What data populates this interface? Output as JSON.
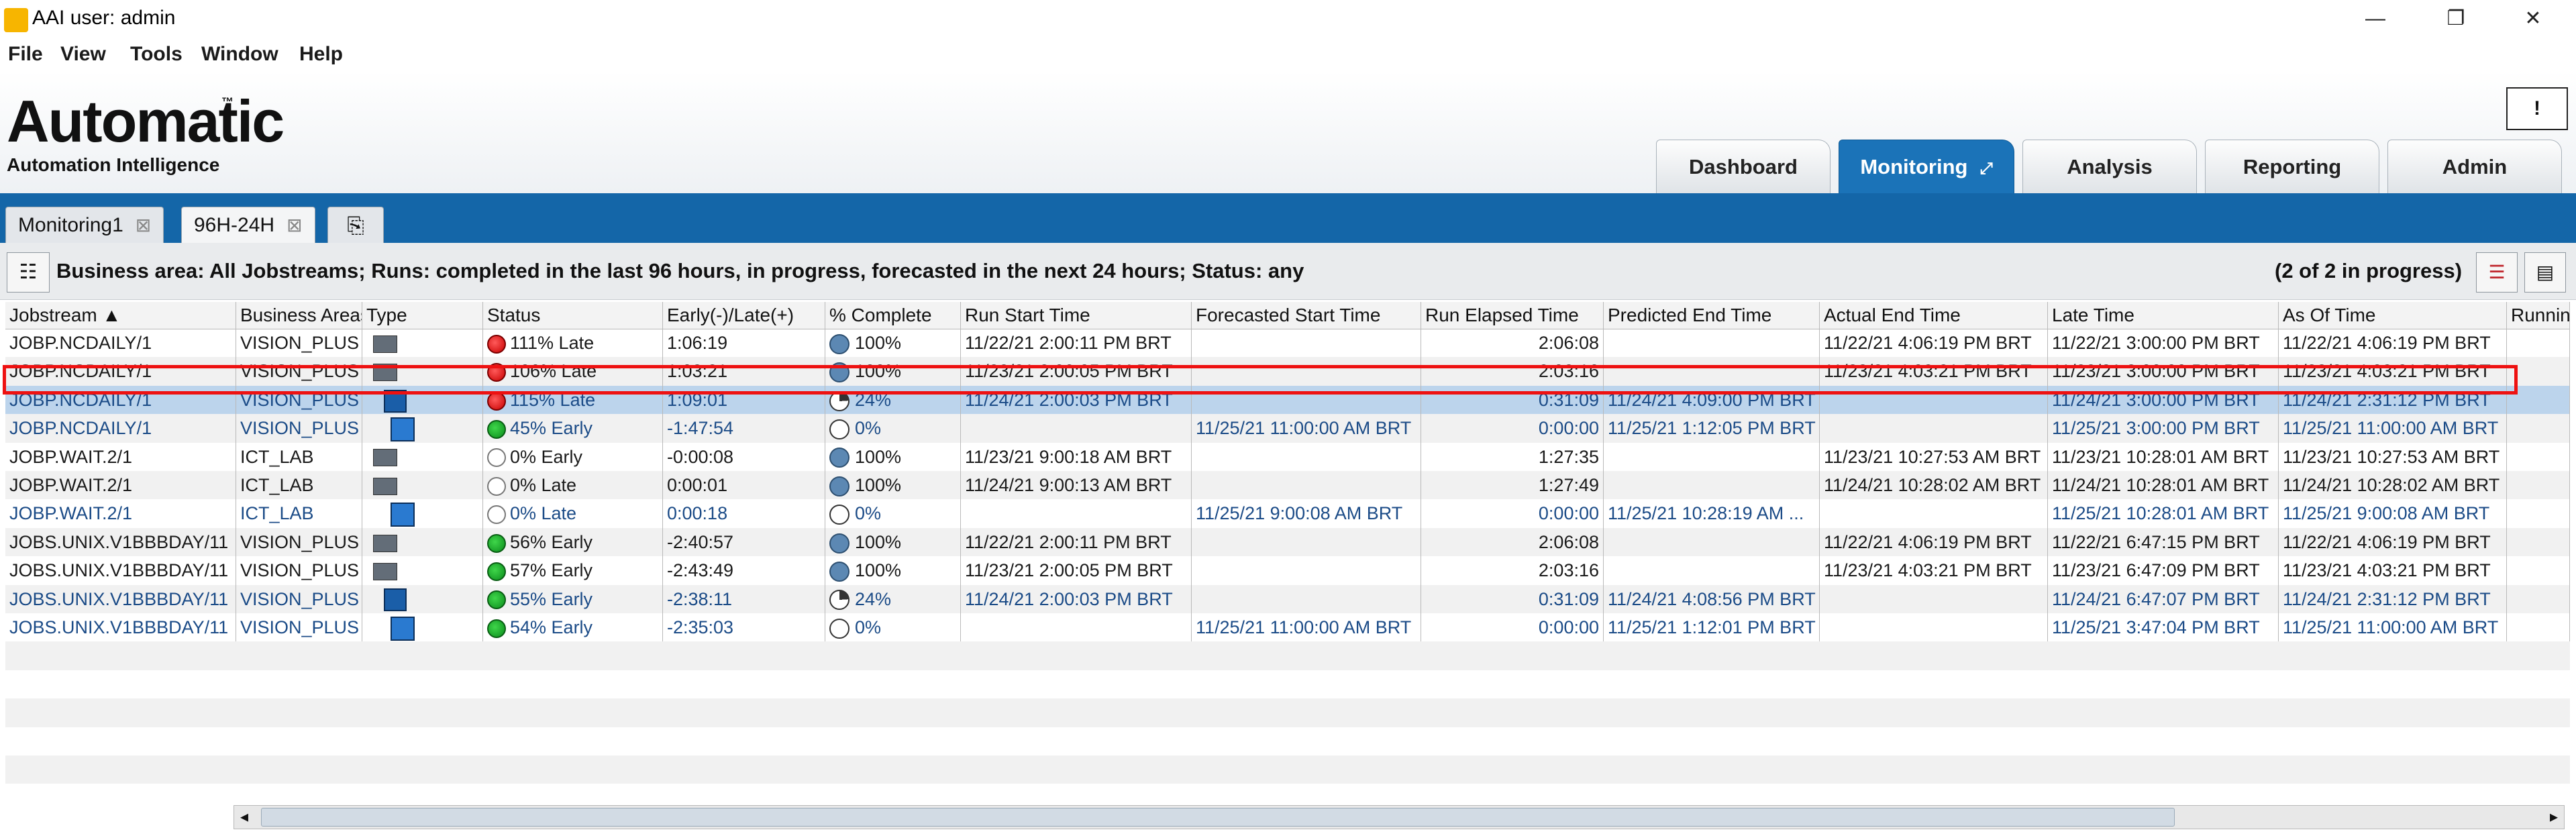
{
  "window": {
    "title": "AAI user: admin",
    "controls": [
      "—",
      "❐",
      "✕"
    ]
  },
  "menu": [
    "File",
    "View",
    "Tools",
    "Window",
    "Help"
  ],
  "brand": {
    "logo": "Automatic",
    "tm": "™",
    "subtitle": "Automation Intelligence"
  },
  "alert_label": "!",
  "main_tabs": [
    "Dashboard",
    "Monitoring",
    "Analysis",
    "Reporting",
    "Admin"
  ],
  "active_tab": "Monitoring",
  "doc_tabs": [
    "Monitoring1",
    "96H-24H"
  ],
  "filter_text": "Business area: All Jobstreams; Runs: completed in the last 96 hours, in progress, forecasted in the next 24 hours; Status: any",
  "progress_text": "(2 of 2 in progress)",
  "columns": [
    "Jobstream ▲",
    "Business Areas",
    "Type",
    "Status",
    "Early(-)/Late(+)",
    "% Complete",
    "Run Start Time",
    "Forecasted Start Time",
    "Run Elapsed Time",
    "Predicted End Time",
    "Actual End Time",
    "Late Time",
    "As Of Time",
    "Runnin"
  ],
  "rows": [
    {
      "style": "dark",
      "jobstream": "JOBP.NCDAILY/1",
      "area": "VISION_PLUS",
      "type": "job",
      "status_icon": "red",
      "status": "111% Late",
      "early_late": "1:06:19",
      "pc_icon": "full",
      "complete": "100%",
      "run_start": "11/22/21 2:00:11 PM BRT",
      "forecast_start": "",
      "elapsed": "2:06:08",
      "pred_end": "",
      "actual_end": "11/22/21 4:06:19 PM BRT",
      "late_time": "11/22/21 3:00:00 PM BRT",
      "as_of": "11/22/21 4:06:19 PM BRT"
    },
    {
      "style": "dark",
      "jobstream": "JOBP.NCDAILY/1",
      "area": "VISION_PLUS",
      "type": "job",
      "status_icon": "red",
      "status": "106% Late",
      "early_late": "1:03:21",
      "pc_icon": "full",
      "complete": "100%",
      "run_start": "11/23/21 2:00:05 PM BRT",
      "forecast_start": "",
      "elapsed": "2:03:16",
      "pred_end": "",
      "actual_end": "11/23/21 4:03:21 PM BRT",
      "late_time": "11/23/21 3:00:00 PM BRT",
      "as_of": "11/23/21 4:03:21 PM BRT"
    },
    {
      "style": "blue",
      "jobstream": "JOBP.NCDAILY/1",
      "area": "VISION_PLUS",
      "type": "stream",
      "status_icon": "red",
      "status": "115% Late",
      "early_late": "1:09:01",
      "pc_icon": "part",
      "complete": "24%",
      "run_start": "11/24/21 2:00:03 PM BRT",
      "forecast_start": "",
      "elapsed": "0:31:09",
      "pred_end": "11/24/21 4:09:00 PM BRT",
      "actual_end": "",
      "late_time": "11/24/21 3:00:00 PM BRT",
      "as_of": "11/24/21 2:31:12 PM BRT"
    },
    {
      "style": "blue",
      "jobstream": "JOBP.NCDAILY/1",
      "area": "VISION_PLUS",
      "type": "stream2",
      "status_icon": "green",
      "status": "45% Early",
      "early_late": "-1:47:54",
      "pc_icon": "empty",
      "complete": "0%",
      "run_start": "",
      "forecast_start": "11/25/21 11:00:00 AM BRT",
      "elapsed": "0:00:00",
      "pred_end": "11/25/21 1:12:05 PM BRT",
      "actual_end": "",
      "late_time": "11/25/21 3:00:00 PM BRT",
      "as_of": "11/25/21 11:00:00 AM BRT"
    },
    {
      "style": "dark",
      "jobstream": "JOBP.WAIT.2/1",
      "area": "ICT_LAB",
      "type": "job",
      "status_icon": "white",
      "status": "0% Early",
      "early_late": "-0:00:08",
      "pc_icon": "full",
      "complete": "100%",
      "run_start": "11/23/21 9:00:18 AM BRT",
      "forecast_start": "",
      "elapsed": "1:27:35",
      "pred_end": "",
      "actual_end": "11/23/21 10:27:53 AM BRT",
      "late_time": "11/23/21 10:28:01 AM BRT",
      "as_of": "11/23/21 10:27:53 AM BRT"
    },
    {
      "style": "dark",
      "jobstream": "JOBP.WAIT.2/1",
      "area": "ICT_LAB",
      "type": "job",
      "status_icon": "white",
      "status": "0% Late",
      "early_late": "0:00:01",
      "pc_icon": "full",
      "complete": "100%",
      "run_start": "11/24/21 9:00:13 AM BRT",
      "forecast_start": "",
      "elapsed": "1:27:49",
      "pred_end": "",
      "actual_end": "11/24/21 10:28:02 AM BRT",
      "late_time": "11/24/21 10:28:01 AM BRT",
      "as_of": "11/24/21 10:28:02 AM BRT"
    },
    {
      "style": "blue",
      "jobstream": "JOBP.WAIT.2/1",
      "area": "ICT_LAB",
      "type": "stream2",
      "status_icon": "white",
      "status": "0% Late",
      "early_late": "0:00:18",
      "pc_icon": "empty",
      "complete": "0%",
      "run_start": "",
      "forecast_start": "11/25/21 9:00:08 AM BRT",
      "elapsed": "0:00:00",
      "pred_end": "11/25/21 10:28:19 AM ...",
      "actual_end": "",
      "late_time": "11/25/21 10:28:01 AM BRT",
      "as_of": "11/25/21 9:00:08 AM BRT"
    },
    {
      "style": "dark",
      "jobstream": "JOBS.UNIX.V1BBBDAY/11",
      "area": "VISION_PLUS",
      "type": "job",
      "status_icon": "green",
      "status": "56% Early",
      "early_late": "-2:40:57",
      "pc_icon": "full",
      "complete": "100%",
      "run_start": "11/22/21 2:00:11 PM BRT",
      "forecast_start": "",
      "elapsed": "2:06:08",
      "pred_end": "",
      "actual_end": "11/22/21 4:06:19 PM BRT",
      "late_time": "11/22/21 6:47:15 PM BRT",
      "as_of": "11/22/21 4:06:19 PM BRT"
    },
    {
      "style": "dark",
      "jobstream": "JOBS.UNIX.V1BBBDAY/11",
      "area": "VISION_PLUS",
      "type": "job",
      "status_icon": "green",
      "status": "57% Early",
      "early_late": "-2:43:49",
      "pc_icon": "full",
      "complete": "100%",
      "run_start": "11/23/21 2:00:05 PM BRT",
      "forecast_start": "",
      "elapsed": "2:03:16",
      "pred_end": "",
      "actual_end": "11/23/21 4:03:21 PM BRT",
      "late_time": "11/23/21 6:47:09 PM BRT",
      "as_of": "11/23/21 4:03:21 PM BRT"
    },
    {
      "style": "blue",
      "jobstream": "JOBS.UNIX.V1BBBDAY/11",
      "area": "VISION_PLUS",
      "type": "stream",
      "status_icon": "green",
      "status": "55% Early",
      "early_late": "-2:38:11",
      "pc_icon": "part",
      "complete": "24%",
      "run_start": "11/24/21 2:00:03 PM BRT",
      "forecast_start": "",
      "elapsed": "0:31:09",
      "pred_end": "11/24/21 4:08:56 PM BRT",
      "actual_end": "",
      "late_time": "11/24/21 6:47:07 PM BRT",
      "as_of": "11/24/21 2:31:12 PM BRT"
    },
    {
      "style": "blue",
      "jobstream": "JOBS.UNIX.V1BBBDAY/11",
      "area": "VISION_PLUS",
      "type": "stream2",
      "status_icon": "green",
      "status": "54% Early",
      "early_late": "-2:35:03",
      "pc_icon": "empty",
      "complete": "0%",
      "run_start": "",
      "forecast_start": "11/25/21 11:00:00 AM BRT",
      "elapsed": "0:00:00",
      "pred_end": "11/25/21 1:12:01 PM BRT",
      "actual_end": "",
      "late_time": "11/25/21 3:47:04 PM BRT",
      "as_of": "11/25/21 11:00:00 AM BRT"
    }
  ],
  "selected_row": 2,
  "highlighted_row": 1,
  "colors": {
    "accent": "#1466a8",
    "highlight_box": "#ee1111",
    "selected_row": "#bcd4ec"
  }
}
